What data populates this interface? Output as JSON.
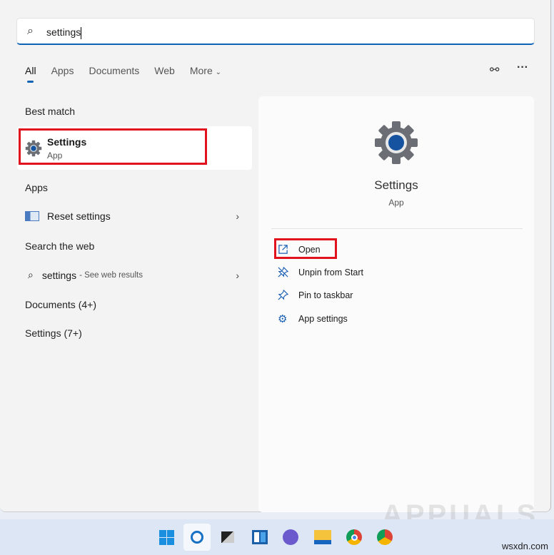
{
  "search": {
    "value": "settings"
  },
  "tabs": [
    "All",
    "Apps",
    "Documents",
    "Web",
    "More"
  ],
  "left": {
    "best_match_heading": "Best match",
    "best_match": {
      "title": "Settings",
      "subtitle": "App"
    },
    "apps_heading": "Apps",
    "apps": [
      {
        "label": "Reset settings"
      }
    ],
    "web_heading": "Search the web",
    "web": {
      "query": "settings",
      "hint": "- See web results"
    },
    "documents": "Documents (4+)",
    "settings": "Settings (7+)"
  },
  "right": {
    "title": "Settings",
    "subtitle": "App",
    "actions": [
      "Open",
      "Unpin from Start",
      "Pin to taskbar",
      "App settings"
    ]
  },
  "watermark": "APPUALS",
  "credit": "wsxdn.com",
  "colors": {
    "accent": "#0f63b4",
    "highlight": "#e0121d"
  }
}
